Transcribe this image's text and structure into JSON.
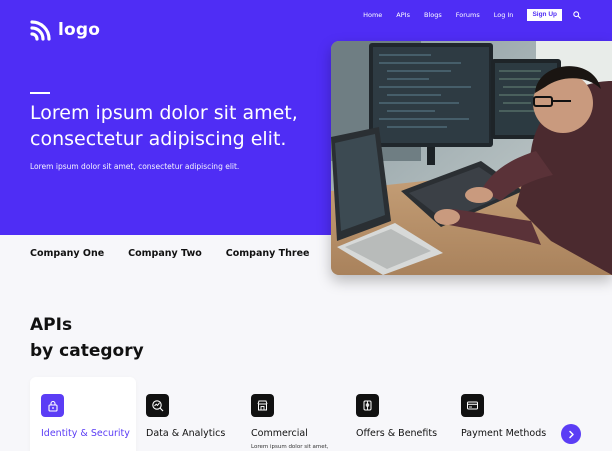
{
  "brand": {
    "logo_text": "logo",
    "accent": "#4f2df5",
    "accent_light": "#5b3df5"
  },
  "nav": {
    "links": [
      "Home",
      "APIs",
      "Blogs",
      "Forums",
      "Log In"
    ],
    "signup_label": "Sign Up",
    "search_icon": "search-icon"
  },
  "hero": {
    "title": "Lorem ipsum dolor sit amet, consectetur adipiscing elit.",
    "subtitle": "Lorem ipsum dolor sit amet, consectetur adipiscing elit.",
    "image": "person-coding-at-computer-photo"
  },
  "companies": [
    "Company One",
    "Company Two",
    "Company Three"
  ],
  "apis_section": {
    "title_line1": "APIs",
    "title_line2": "by category"
  },
  "categories": [
    {
      "label": "Identity & Security",
      "icon": "lock-icon",
      "active": true,
      "desc": ""
    },
    {
      "label": "Data & Analytics",
      "icon": "analytics-icon",
      "active": false,
      "desc": ""
    },
    {
      "label": "Commercial",
      "icon": "storefront-icon",
      "active": false,
      "desc": "Lorem ipsum dolor sit amet,"
    },
    {
      "label": "Offers & Benefits",
      "icon": "gift-icon",
      "active": false,
      "desc": ""
    },
    {
      "label": "Payment Methods",
      "icon": "credit-card-icon",
      "active": false,
      "desc": ""
    }
  ],
  "carousel": {
    "next_icon": "chevron-right-icon"
  }
}
